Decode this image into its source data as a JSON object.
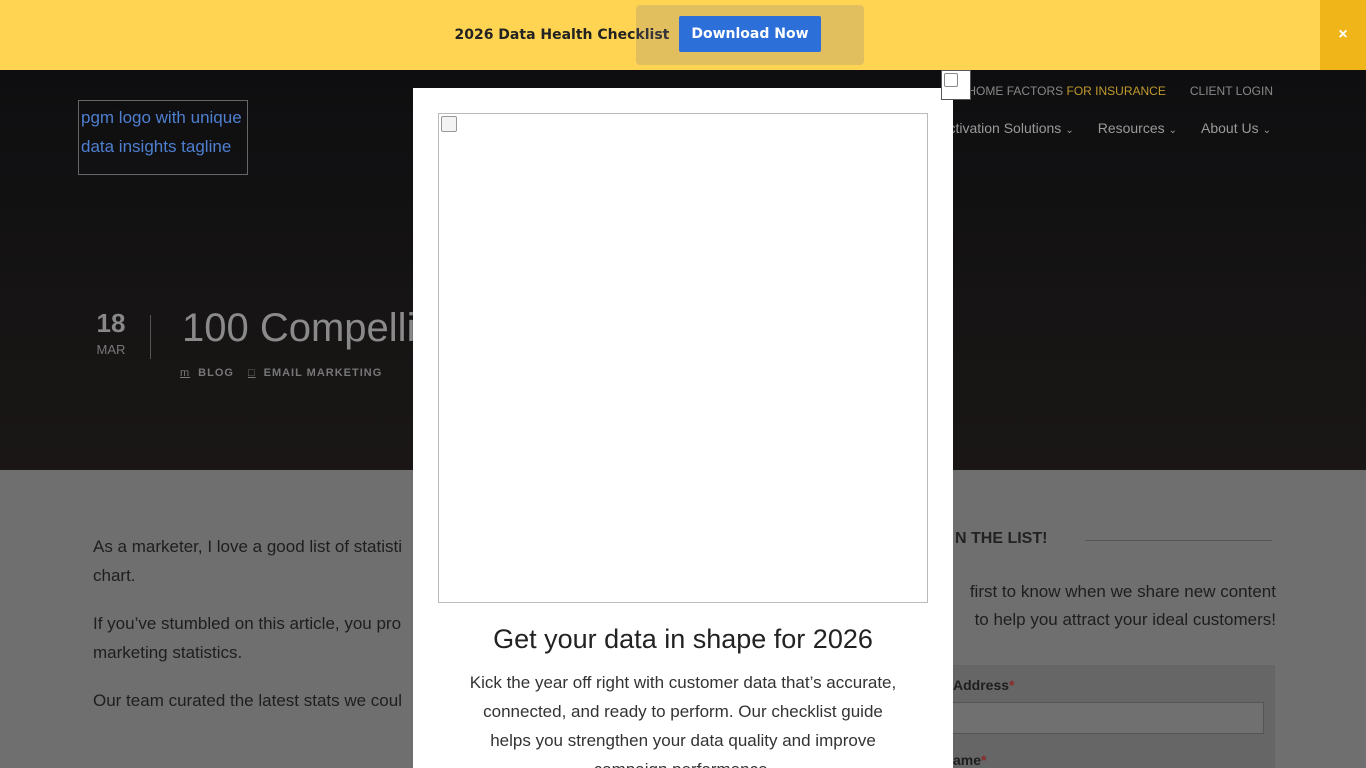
{
  "promo": {
    "text": "2026 Data Health Checklist",
    "button": "Download Now",
    "close": "×"
  },
  "header": {
    "logo_alt": "pgm logo with unique data insights tagline",
    "top_nav": {
      "home_factors": "HOME FACTORS",
      "for_insurance": "FOR INSURANCE",
      "client_login": "CLIENT LOGIN"
    },
    "main_nav": [
      "ctivation Solutions",
      "Resources",
      "About Us"
    ]
  },
  "post": {
    "day": "18",
    "month": "MAR",
    "title": "100 Compelli",
    "meta": [
      {
        "icon": "m",
        "label": "BLOG"
      },
      {
        "icon": "",
        "label": "EMAIL MARKETING"
      }
    ]
  },
  "article": {
    "paragraphs": [
      "As a marketer, I love a good list of statisti chart.",
      "If you’ve stumbled on this article, you pro marketing statistics.",
      "Our team curated the latest stats we coul"
    ]
  },
  "sidebar": {
    "heading": "N THE LIST!",
    "text": "first to know when we share new content to help you attract your ideal customers!",
    "email_label": "Address",
    "name_label": "ame",
    "required_mark": "*"
  },
  "modal": {
    "title": "Get your data in shape for 2026",
    "body": "Kick the year off right with customer data that’s accurate, connected, and ready to perform. Our checklist guide helps you strengthen your data quality and improve campaign performance."
  }
}
